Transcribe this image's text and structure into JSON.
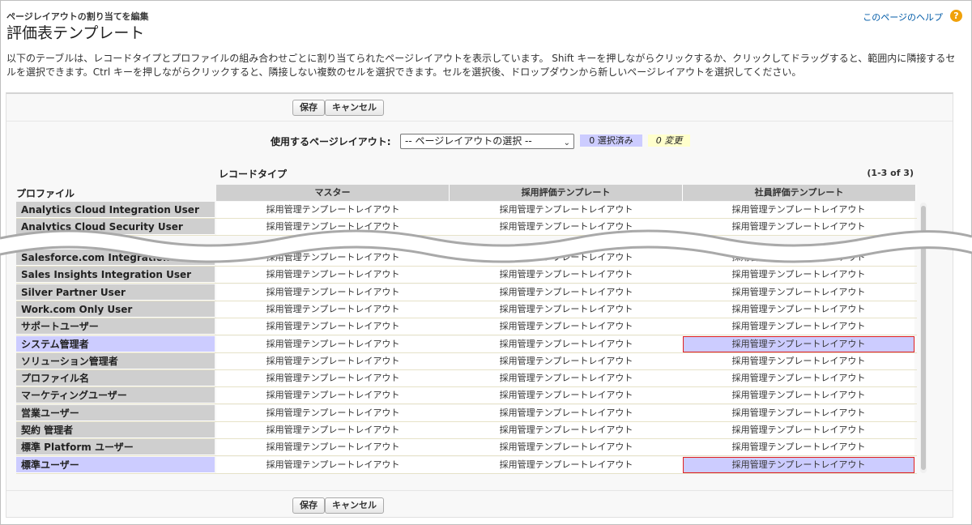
{
  "header": {
    "subtitle": "ページレイアウトの割り当てを編集",
    "title": "評価表テンプレート",
    "help_link": "このページのヘルプ",
    "help_icon": "?"
  },
  "description": "以下のテーブルは、レコードタイプとプロファイルの組み合わせごとに割り当てられたページレイアウトを表示しています。 Shift キーを押しながらクリックするか、クリックしてドラッグすると、範囲内に隣接するセルを選択できます。Ctrl キーを押しながらクリックすると、隣接しない複数のセルを選択できます。セルを選択後、ドロップダウンから新しいページレイアウトを選択してください。",
  "buttons": {
    "save": "保存",
    "cancel": "キャンセル"
  },
  "layout_selector": {
    "label": "使用するページレイアウト:",
    "value": "-- ページレイアウトの選択 --",
    "caret": "⌄",
    "selected_count": "0 選択済み",
    "change_count": "0 変更"
  },
  "table": {
    "record_type_label": "レコードタイプ",
    "range": "(1-3 of 3)",
    "profile_header": "プロファイル",
    "columns": [
      "マスター",
      "採用評価テンプレート",
      "社員評価テンプレート"
    ],
    "cell_value": "採用管理テンプレートレイアウト",
    "rows_top": [
      {
        "profile": "Analytics Cloud Integration User",
        "cells": [
          "採用管理テンプレートレイアウト",
          "採用管理テンプレートレイアウト",
          "採用管理テンプレートレイアウト"
        ]
      },
      {
        "profile": "Analytics Cloud Security User",
        "cells": [
          "採用管理テンプレートレイアウト",
          "採用管理テンプレートレイアウト",
          "採用管理テンプレートレイアウト"
        ]
      }
    ],
    "rows_bottom": [
      {
        "profile": "Salesforce.com Integration User",
        "cells": [
          "採用管理テンプレートレイアウト",
          "採用管理テンプレートレイアウト",
          "採用管理テンプレートレイアウト"
        ]
      },
      {
        "profile": "Sales Insights Integration User",
        "cells": [
          "採用管理テンプレートレイアウト",
          "採用管理テンプレートレイアウト",
          "採用管理テンプレートレイアウト"
        ]
      },
      {
        "profile": "Silver Partner User",
        "cells": [
          "採用管理テンプレートレイアウト",
          "採用管理テンプレートレイアウト",
          "採用管理テンプレートレイアウト"
        ]
      },
      {
        "profile": "Work.com Only User",
        "cells": [
          "採用管理テンプレートレイアウト",
          "採用管理テンプレートレイアウト",
          "採用管理テンプレートレイアウト"
        ]
      },
      {
        "profile": "サポートユーザー",
        "cells": [
          "採用管理テンプレートレイアウト",
          "採用管理テンプレートレイアウト",
          "採用管理テンプレートレイアウト"
        ]
      },
      {
        "profile": "システム管理者",
        "selected": true,
        "cells": [
          "採用管理テンプレートレイアウト",
          "採用管理テンプレートレイアウト",
          "採用管理テンプレートレイアウト"
        ]
      },
      {
        "profile": "ソリューション管理者",
        "cells": [
          "採用管理テンプレートレイアウト",
          "採用管理テンプレートレイアウト",
          "採用管理テンプレートレイアウト"
        ]
      },
      {
        "profile": "プロファイル名",
        "cells": [
          "採用管理テンプレートレイアウト",
          "採用管理テンプレートレイアウト",
          "採用管理テンプレートレイアウト"
        ]
      },
      {
        "profile": "マーケティングユーザー",
        "cells": [
          "採用管理テンプレートレイアウト",
          "採用管理テンプレートレイアウト",
          "採用管理テンプレートレイアウト"
        ]
      },
      {
        "profile": "営業ユーザー",
        "cells": [
          "採用管理テンプレートレイアウト",
          "採用管理テンプレートレイアウト",
          "採用管理テンプレートレイアウト"
        ]
      },
      {
        "profile": "契約 管理者",
        "cells": [
          "採用管理テンプレートレイアウト",
          "採用管理テンプレートレイアウト",
          "採用管理テンプレートレイアウト"
        ]
      },
      {
        "profile": "標準 Platform ユーザー",
        "cells": [
          "採用管理テンプレートレイアウト",
          "採用管理テンプレートレイアウト",
          "採用管理テンプレートレイアウト"
        ]
      },
      {
        "profile": "標準ユーザー",
        "selected": true,
        "cells": [
          "採用管理テンプレートレイアウト",
          "採用管理テンプレートレイアウト",
          "採用管理テンプレートレイアウト"
        ]
      }
    ]
  },
  "colors": {
    "selected_bg": "#ccccff",
    "selected_border": "#e02020",
    "header_bg": "#cfcfcf",
    "link": "#015ba7"
  }
}
